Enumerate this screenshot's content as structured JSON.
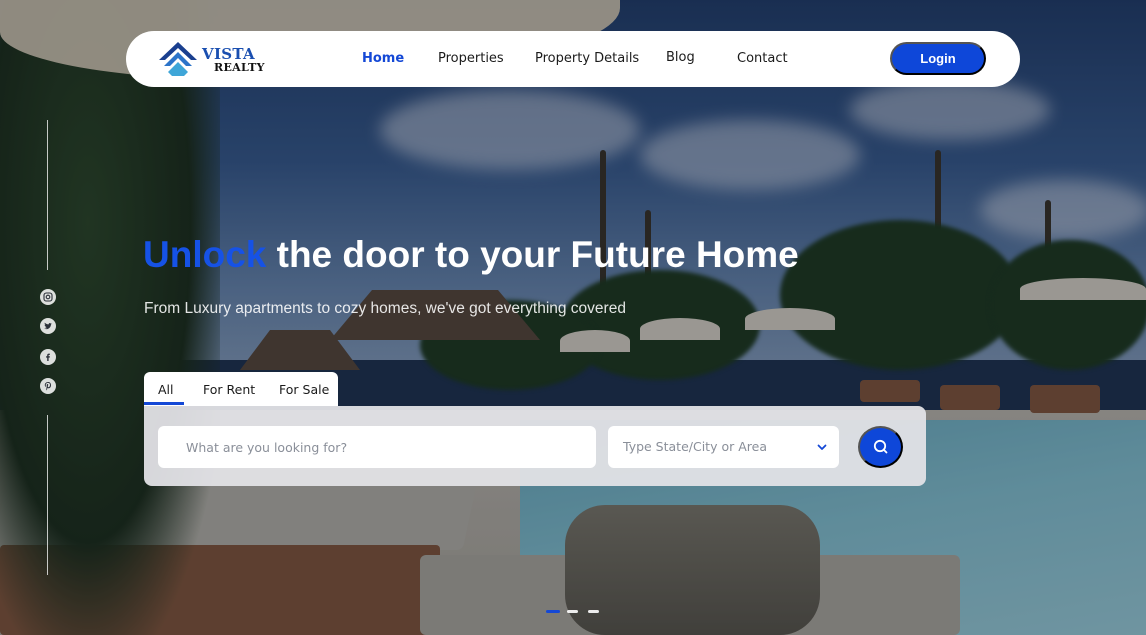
{
  "brand": {
    "name_line1": "Vista",
    "name_line2": "Realty",
    "color": "#1a4fb0"
  },
  "nav": {
    "links": [
      {
        "label": "Home",
        "active": true
      },
      {
        "label": "Properties",
        "active": false
      },
      {
        "label": "Property Details",
        "active": false
      },
      {
        "label": "Blog",
        "active": false
      },
      {
        "label": "Contact",
        "active": false
      }
    ],
    "login_label": "Login",
    "accent_color": "#0e47d9"
  },
  "social": {
    "icons": [
      "instagram-icon",
      "twitter-icon",
      "facebook-icon",
      "pinterest-icon"
    ]
  },
  "hero": {
    "headline_accent": "Unlock",
    "headline_rest": " the door to your Future Home",
    "subheadline": "From Luxury apartments to cozy homes, we've got everything covered"
  },
  "search": {
    "tabs": [
      {
        "label": "All",
        "active": true
      },
      {
        "label": "For Rent",
        "active": false
      },
      {
        "label": "For Sale",
        "active": false
      }
    ],
    "keyword_placeholder": "What are you looking for?",
    "location_placeholder": "Type State/City or Area",
    "icons": {
      "location_dropdown": "chevron-down-icon",
      "submit": "search-icon"
    }
  },
  "slider": {
    "slide_count": 3,
    "active_slide": 1
  }
}
